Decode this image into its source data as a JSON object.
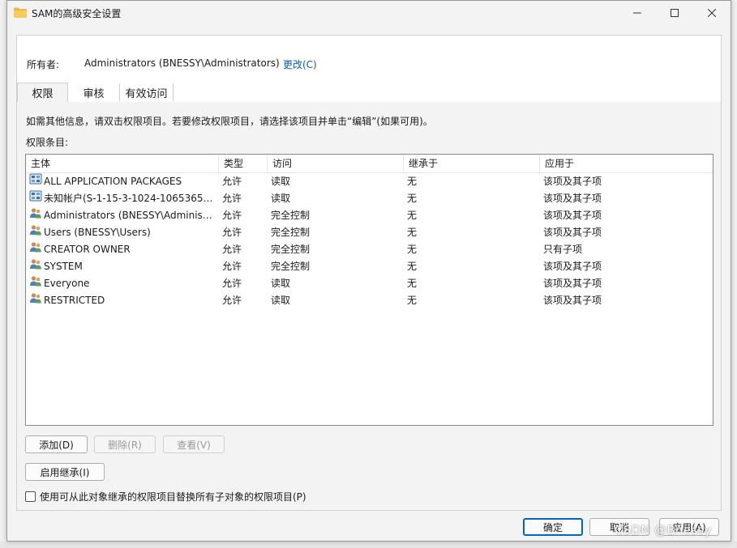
{
  "window": {
    "title": "SAM的高级安全设置"
  },
  "owner": {
    "label": "所有者:",
    "value": "Administrators (BNESSY\\Administrators)",
    "change_link": "更改(C)"
  },
  "tabs": [
    {
      "label": "权限"
    },
    {
      "label": "审核"
    },
    {
      "label": "有效访问"
    }
  ],
  "info_text": "如需其他信息，请双击权限项目。若要修改权限项目，请选择该项目并单击“编辑”(如果可用)。",
  "entries_label": "权限条目:",
  "columns": [
    "主体",
    "类型",
    "访问",
    "继承于",
    "应用于"
  ],
  "entries": [
    {
      "principal": "ALL APPLICATION PACKAGES",
      "type": "允许",
      "access": "读取",
      "inherited_from": "无",
      "applies_to": "该项及其子项",
      "icon": "app-package-icon"
    },
    {
      "principal": "未知帐户(S-1-15-3-1024-1065365936...",
      "type": "允许",
      "access": "读取",
      "inherited_from": "无",
      "applies_to": "该项及其子项",
      "icon": "app-package-icon"
    },
    {
      "principal": "Administrators (BNESSY\\Administrators)",
      "type": "允许",
      "access": "完全控制",
      "inherited_from": "无",
      "applies_to": "该项及其子项",
      "icon": "user-group-icon"
    },
    {
      "principal": "Users (BNESSY\\Users)",
      "type": "允许",
      "access": "完全控制",
      "inherited_from": "无",
      "applies_to": "该项及其子项",
      "icon": "user-group-icon"
    },
    {
      "principal": "CREATOR OWNER",
      "type": "允许",
      "access": "完全控制",
      "inherited_from": "无",
      "applies_to": "只有子项",
      "icon": "user-group-icon"
    },
    {
      "principal": "SYSTEM",
      "type": "允许",
      "access": "完全控制",
      "inherited_from": "无",
      "applies_to": "该项及其子项",
      "icon": "user-group-icon"
    },
    {
      "principal": "Everyone",
      "type": "允许",
      "access": "读取",
      "inherited_from": "无",
      "applies_to": "该项及其子项",
      "icon": "user-group-icon"
    },
    {
      "principal": "RESTRICTED",
      "type": "允许",
      "access": "读取",
      "inherited_from": "无",
      "applies_to": "该项及其子项",
      "icon": "user-group-icon"
    }
  ],
  "buttons": {
    "add": "添加(D)",
    "delete": "删除(R)",
    "view": "查看(V)",
    "enable_inheritance": "启用继承(I)",
    "ok": "确定",
    "cancel": "取消",
    "apply": "应用(A)"
  },
  "replace_checkbox": {
    "label": "使用可从此对象继承的权限项目替换所有子对象的权限项目(P)",
    "checked": false
  },
  "watermark": "CSDN @Bnessy",
  "colors": {
    "accent": "#0067c0",
    "link": "#0b5cad",
    "folder": "#e8b84a"
  }
}
